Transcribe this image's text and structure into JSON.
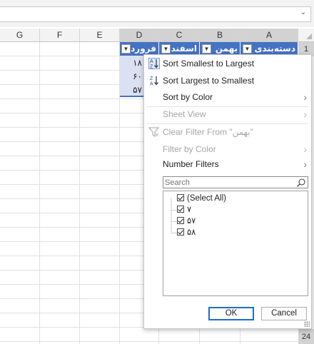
{
  "columns": {
    "g": "G",
    "f": "F",
    "e": "E",
    "d": "D",
    "c": "C",
    "b": "B",
    "a": "A"
  },
  "rows": {
    "r1": "1",
    "r24": "24"
  },
  "header_cells": {
    "a": "دسته‌بندی",
    "b": "بهمن",
    "c": "اسفند",
    "d": "فروردی"
  },
  "data_cells": [
    "۱۸",
    "۶۰",
    "۵۷"
  ],
  "filter_menu": {
    "sort_asc": "Sort Smallest to Largest",
    "sort_desc": "Sort Largest to Smallest",
    "sort_by_color": "Sort by Color",
    "sheet_view": "Sheet View",
    "clear_filter": "Clear Filter From \"بهمن\"",
    "filter_by_color": "Filter by Color",
    "number_filters": "Number Filters",
    "search_placeholder": "Search",
    "values": [
      {
        "label": "(Select All)",
        "checked": true
      },
      {
        "label": "۷",
        "checked": true
      },
      {
        "label": "۵۷",
        "checked": true
      },
      {
        "label": "۵۸",
        "checked": true
      }
    ],
    "ok": "OK",
    "cancel": "Cancel"
  },
  "colors": {
    "header_fill": "#4472c4",
    "selected_fill": "#d9e1f2",
    "accent_blue": "#1a6dcc"
  },
  "icons": {
    "sort_asc": "sort-ascending-icon",
    "sort_desc": "sort-descending-icon",
    "clear_filter": "funnel-clear-icon",
    "search": "magnifier-icon",
    "submenu": "chevron-right-icon",
    "filter_dropdown": "dropdown-arrow-icon",
    "filter_active": "filter-funnel-icon"
  }
}
